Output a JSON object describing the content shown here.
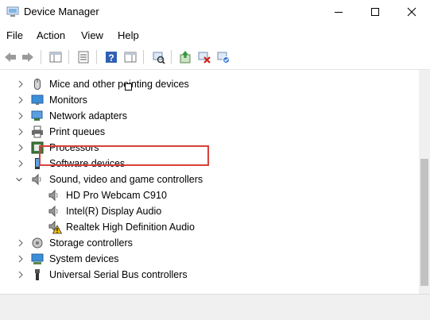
{
  "window": {
    "title": "Device Manager"
  },
  "menu": [
    "File",
    "Action",
    "View",
    "Help"
  ],
  "toolbar": {
    "buttons": [
      "back-icon",
      "forward-icon",
      "show-hide-console-tree-icon",
      "properties-icon",
      "help-icon",
      "action-pane-icon",
      "scan-hardware-icon",
      "update-driver-icon",
      "disable-device-icon",
      "uninstall-device-icon"
    ]
  },
  "tree": {
    "items": [
      {
        "label": "Mice and other pointing devices",
        "expanded": false,
        "icon": "mouse-icon"
      },
      {
        "label": "Monitors",
        "expanded": false,
        "icon": "monitor-icon"
      },
      {
        "label": "Network adapters",
        "expanded": false,
        "icon": "network-adapter-icon"
      },
      {
        "label": "Print queues",
        "expanded": false,
        "icon": "printer-icon"
      },
      {
        "label": "Processors",
        "expanded": false,
        "icon": "processor-icon"
      },
      {
        "label": "Software devices",
        "expanded": false,
        "icon": "software-device-icon"
      },
      {
        "label": "Sound, video and game controllers",
        "expanded": true,
        "icon": "speaker-icon"
      },
      {
        "label": "HD Pro Webcam C910",
        "child": true,
        "icon": "speaker-icon"
      },
      {
        "label": "Intel(R) Display Audio",
        "child": true,
        "icon": "speaker-icon"
      },
      {
        "label": "Realtek High Definition Audio",
        "child": true,
        "icon": "speaker-warning-icon",
        "warning": true,
        "highlighted": true
      },
      {
        "label": "Storage controllers",
        "expanded": false,
        "icon": "storage-controller-icon"
      },
      {
        "label": "System devices",
        "expanded": false,
        "icon": "system-device-icon"
      },
      {
        "label": "Universal Serial Bus controllers",
        "expanded": false,
        "icon": "usb-icon"
      }
    ]
  },
  "colors": {
    "highlight_border": "#d9403a",
    "warning": "#f5c400"
  }
}
